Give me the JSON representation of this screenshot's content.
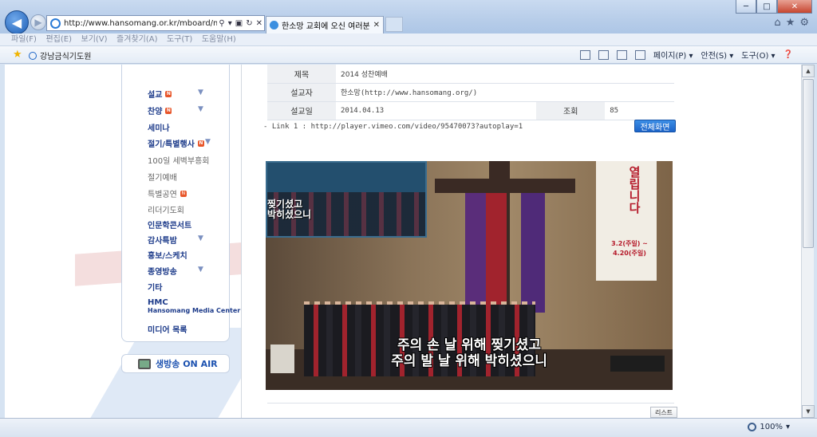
{
  "browser": {
    "address_url": "http://www.hansomang.or.kr/mboard/mboarc",
    "tab_title": "한소망 교회에 오신 여러분...",
    "window_buttons": [
      "─",
      "□",
      "✕"
    ],
    "menu": [
      "파일(F)",
      "편집(E)",
      "보기(V)",
      "즐겨찾기(A)",
      "도구(T)",
      "도움말(H)"
    ],
    "favorite_item": "강남금식기도원",
    "command_items": [
      "페이지(P) ▾",
      "안전(S) ▾",
      "도구(O) ▾"
    ],
    "zoom": "100%"
  },
  "sidebar": {
    "items": [
      {
        "label": "설교",
        "badge": "N",
        "expand": true
      },
      {
        "label": "찬양",
        "badge": "N",
        "expand": true
      },
      {
        "label": "세미나"
      },
      {
        "label": "절기/특별행사",
        "badge": "N",
        "expand": true
      },
      {
        "label": "100일 세벽부흥회"
      },
      {
        "label": "절기예배"
      },
      {
        "label": "특별공연",
        "badge": "N"
      },
      {
        "label": "리더기도회"
      },
      {
        "label": "인문학콘서트"
      },
      {
        "label": "감사특밤",
        "expand": true
      },
      {
        "label": "홍보/스케치"
      },
      {
        "label": "종영방송",
        "expand": true
      },
      {
        "label": "기타"
      },
      {
        "label": "HMC",
        "sublabel": "Hansomang Media Center"
      },
      {
        "label": "미디어 목록"
      }
    ],
    "onair_label": "생방송 ON AIR"
  },
  "post": {
    "title_label": "제목",
    "title_value": "2014 성찬예배",
    "preacher_label": "설교자",
    "preacher_value": "한소망(http://www.hansomang.org/)",
    "date_label": "설교일",
    "date_value": "2014.04.13",
    "views_label": "조회",
    "views_value": "85",
    "link_line": "- Link 1 : http://player.vimeo.com/video/95470073?autoplay=1",
    "fullscreen_label": "전체화면",
    "list_label": "리스트"
  },
  "video": {
    "screen_caption": "찢기셨고\n박히셨으니",
    "banner_text": "열립니다",
    "banner_dates": "3.2(주일) ~\n4.20(주일)",
    "subtitle": "주의 손 날 위해 찢기셨고\n주의 발 날 위해 박히셨으니"
  }
}
